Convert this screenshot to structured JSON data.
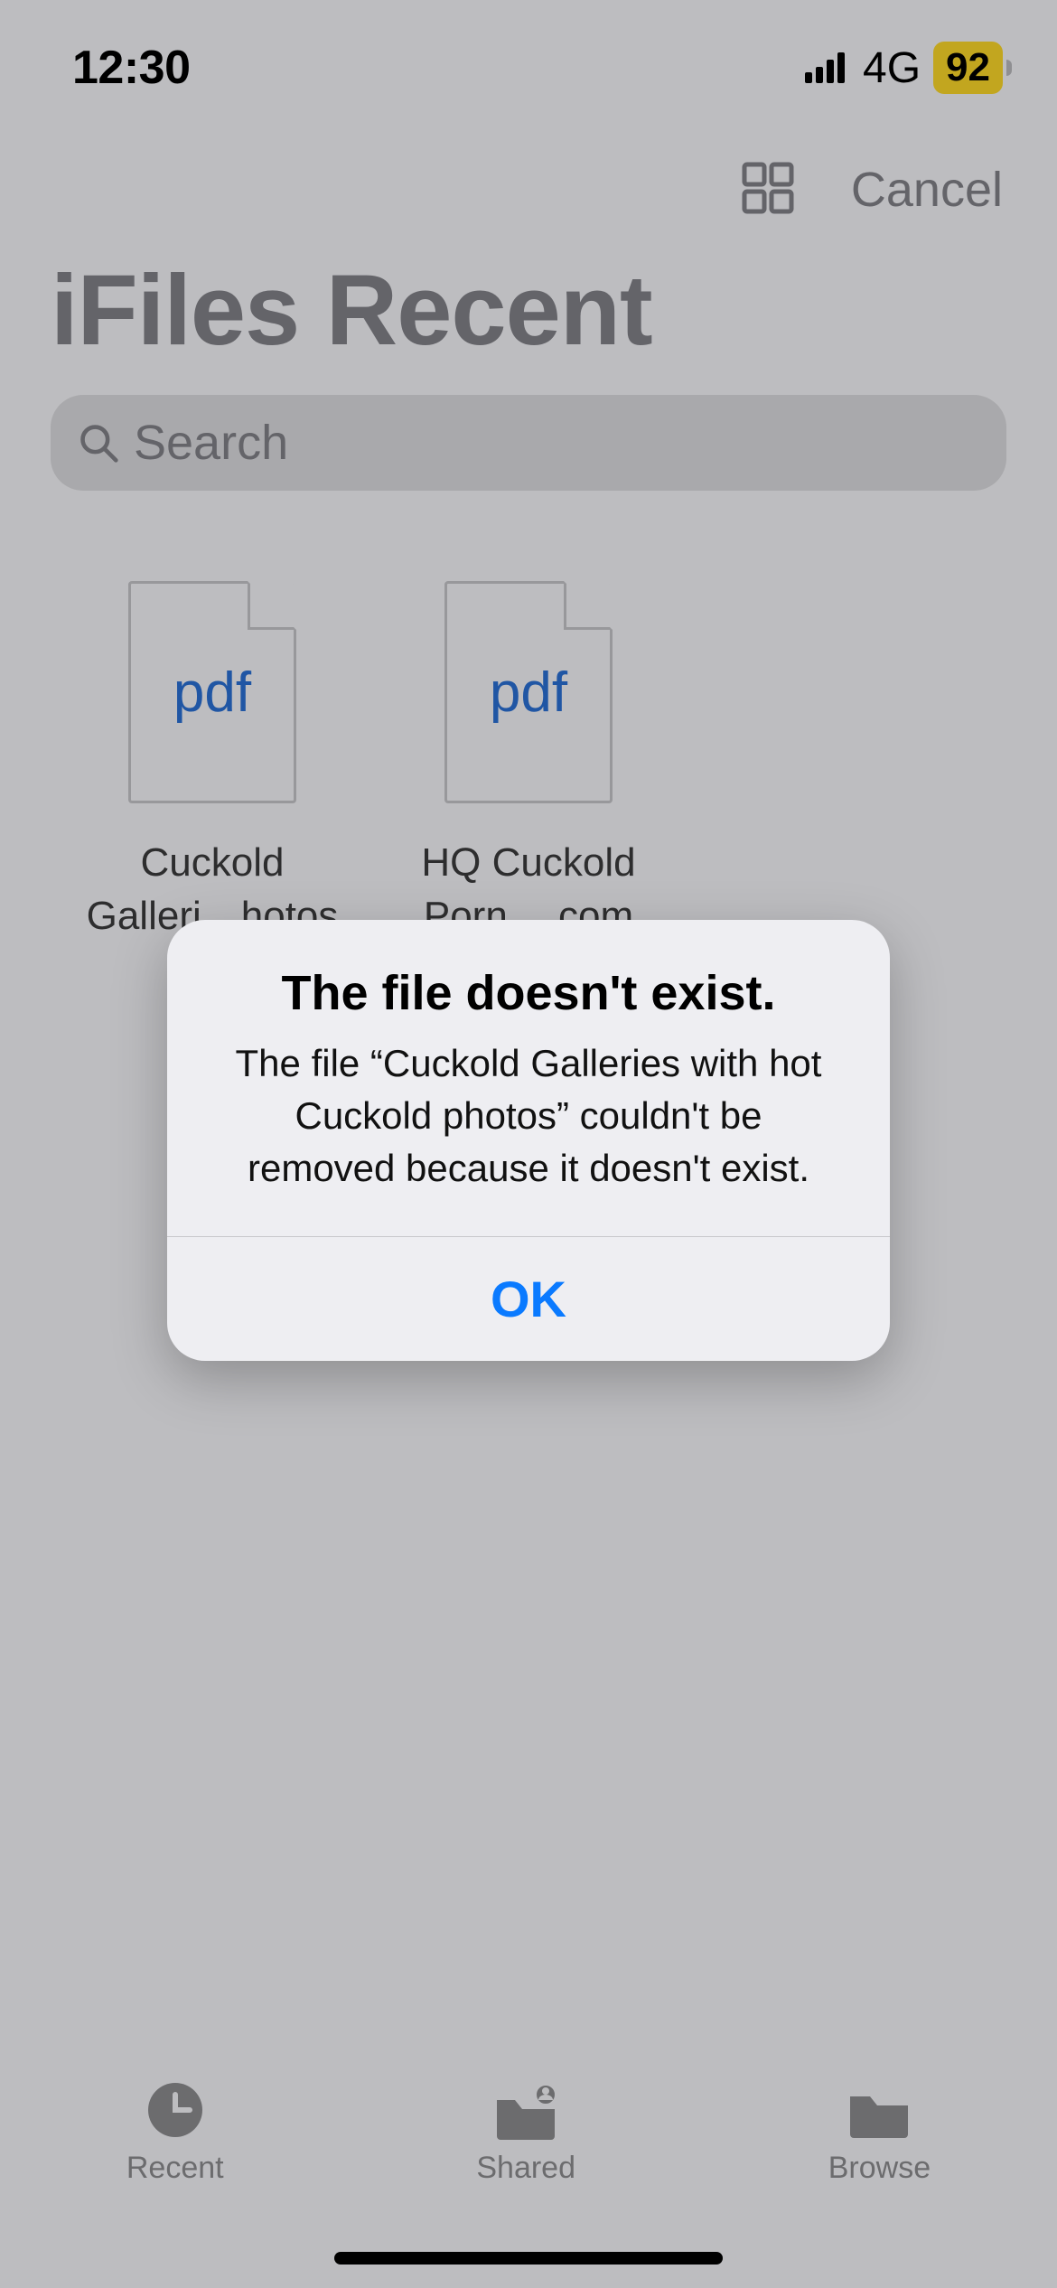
{
  "status": {
    "time": "12:30",
    "network": "4G",
    "battery": "92"
  },
  "nav": {
    "cancel": "Cancel"
  },
  "page": {
    "title": "iFiles Recent"
  },
  "search": {
    "placeholder": "Search"
  },
  "files": [
    {
      "ext": "pdf",
      "name": "Cuckold Galleri…hotos",
      "meta_visible": "0"
    },
    {
      "ext": "pdf",
      "name": "HQ Cuckold Porn….com",
      "meta_visible": ""
    }
  ],
  "tabs": {
    "recent": "Recent",
    "shared": "Shared",
    "browse": "Browse"
  },
  "alert": {
    "title": "The file doesn't exist.",
    "message": "The file “Cuckold Galleries with hot Cuckold photos” couldn't be removed because it doesn't exist.",
    "ok": "OK"
  }
}
